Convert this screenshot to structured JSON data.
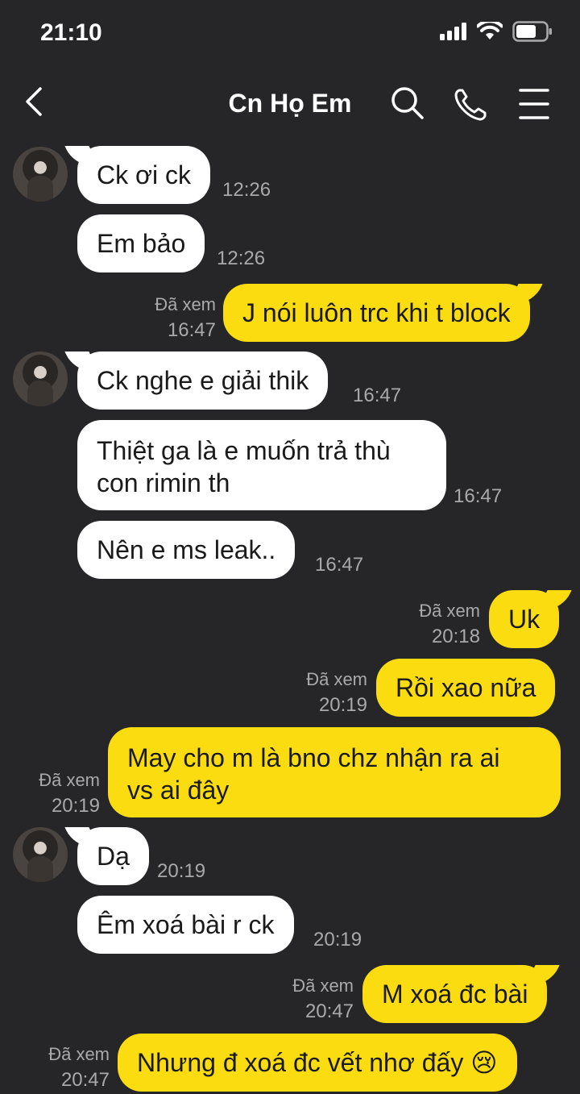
{
  "status": {
    "time": "21:10"
  },
  "header": {
    "title": "Cn Họ Em"
  },
  "messages": [
    {
      "text": "Ck ơi ck",
      "time": "12:26"
    },
    {
      "text": "Em bảo",
      "time": "12:26"
    },
    {
      "text": "J nói luôn trc khi t block",
      "seen": "Đã xem",
      "time": "16:47"
    },
    {
      "text": "Ck nghe e giải thik",
      "time": "16:47"
    },
    {
      "line1": "Thiệt ga là e muốn trả thù",
      "line2": "con rimin th",
      "time": "16:47"
    },
    {
      "text": "Nên e ms leak..",
      "time": "16:47"
    },
    {
      "text": "Uk",
      "seen": "Đã xem",
      "time": "20:18"
    },
    {
      "text": "Rồi xao nữa",
      "seen": "Đã xem",
      "time": "20:19"
    },
    {
      "line1": "May cho m là bno chz nhận ra ai",
      "line2": "vs ai đây",
      "seen": "Đã xem",
      "time": "20:19"
    },
    {
      "text": "Dạ",
      "time": "20:19"
    },
    {
      "text": "Êm xoá bài r ck",
      "time": "20:19"
    },
    {
      "text": "M xoá đc bài",
      "seen": "Đã xem",
      "time": "20:47"
    },
    {
      "text": "Nhưng đ xoá đc vết nhơ đấy",
      "emoji": "😢",
      "seen": "Đã xem",
      "time": "20:47"
    }
  ],
  "colors": {
    "background": "#262628",
    "outgoing": "#fbdc10",
    "incoming": "#ffffff",
    "meta": "#a9a9ad"
  },
  "icons": [
    "signal-icon",
    "wifi-icon",
    "battery-icon",
    "back-icon",
    "search-icon",
    "phone-icon",
    "menu-icon",
    "avatar"
  ]
}
